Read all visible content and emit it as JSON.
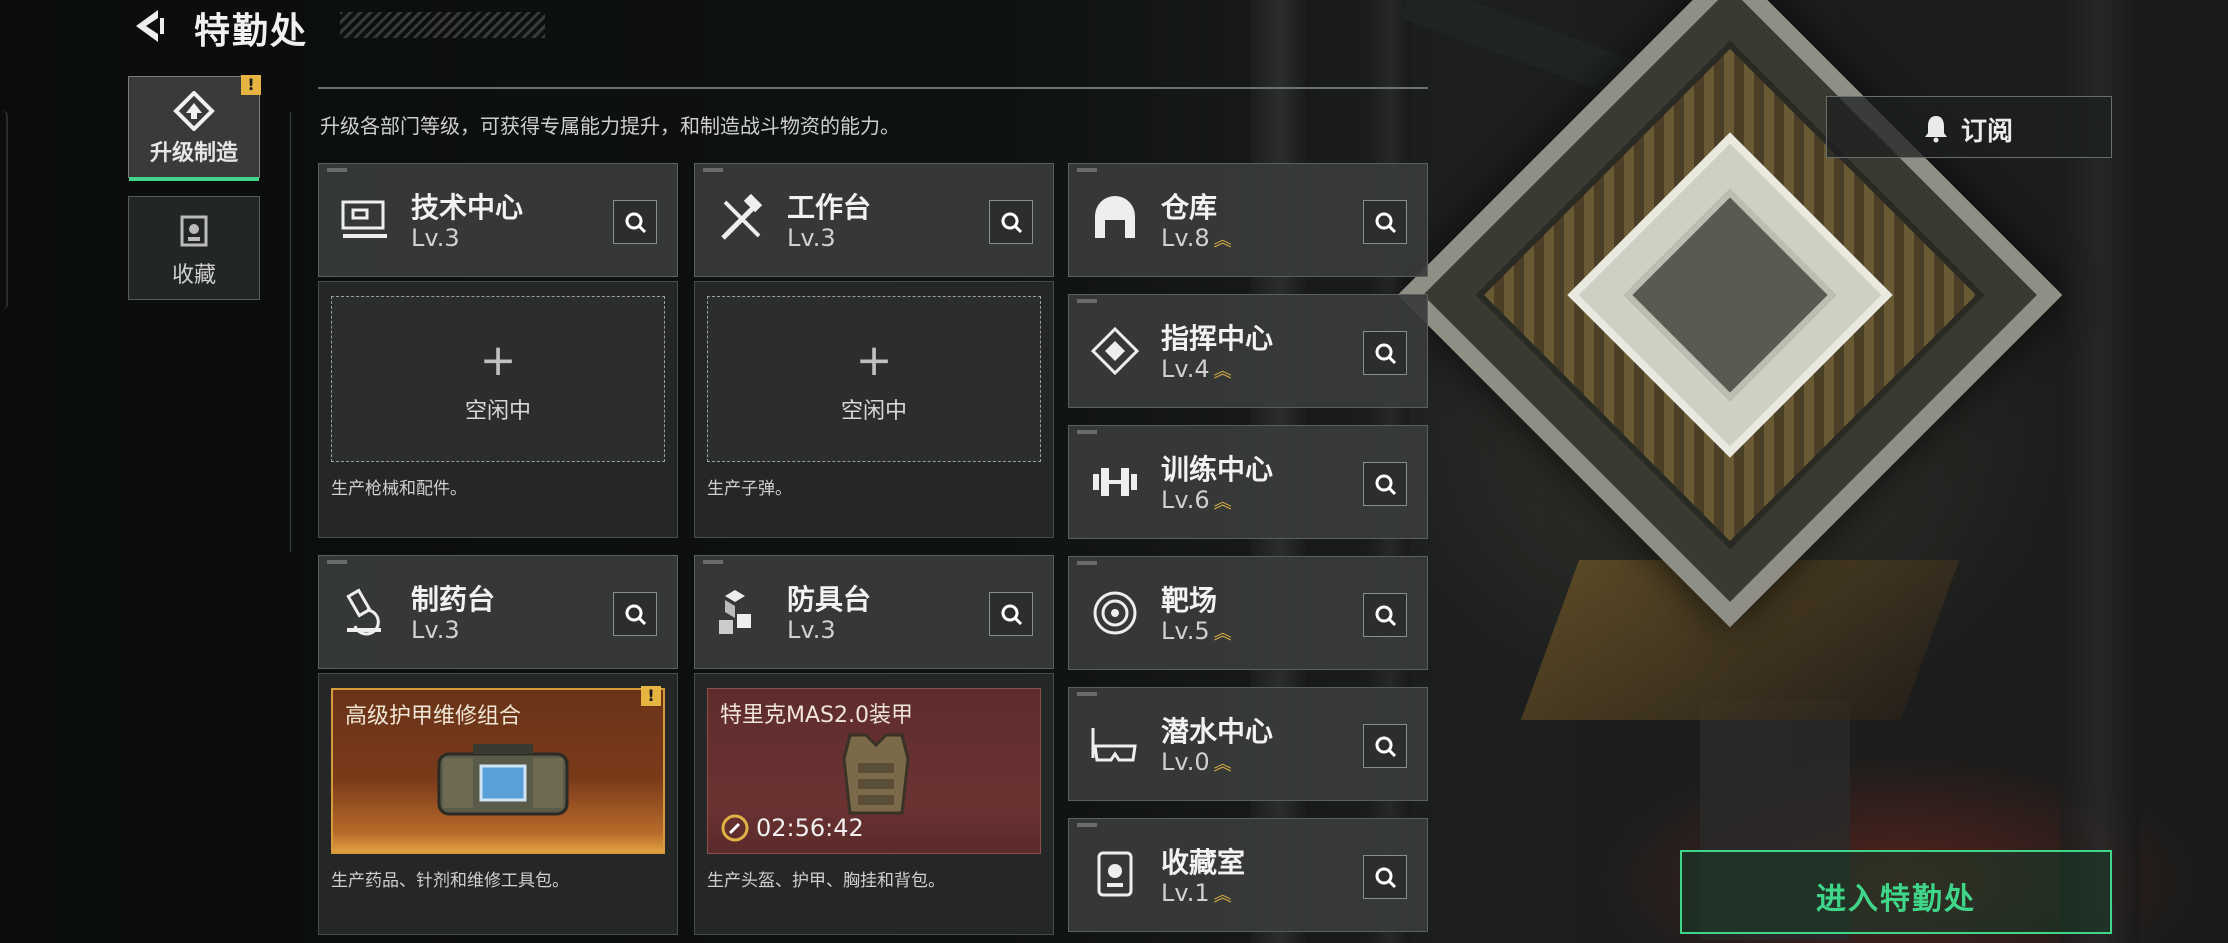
{
  "header": {
    "title": "特勤处"
  },
  "sidebar": {
    "tabs": [
      {
        "label": "升级制造",
        "active": true,
        "badge": "!"
      },
      {
        "label": "收藏",
        "active": false
      }
    ]
  },
  "description": "升级各部门等级，可获得专属能力提升，和制造战斗物资的能力。",
  "subscribe_label": "订阅",
  "enter_label": "进入特勤处",
  "production": [
    {
      "name": "技术中心",
      "level": "Lv.3",
      "icon": "tech-center-icon",
      "slot": {
        "state": "空闲中"
      },
      "desc": "生产枪械和配件。"
    },
    {
      "name": "工作台",
      "level": "Lv.3",
      "icon": "workbench-icon",
      "slot": {
        "state": "空闲中"
      },
      "desc": "生产子弹。"
    },
    {
      "name": "制药台",
      "level": "Lv.3",
      "icon": "pharmacy-icon",
      "slot": {
        "item": "高级护甲维修组合",
        "badge": "!"
      },
      "desc": "生产药品、针剂和维修工具包。"
    },
    {
      "name": "防具台",
      "level": "Lv.3",
      "icon": "armor-bench-icon",
      "slot": {
        "item": "特里克MAS2.0装甲",
        "timer": "02:56:42"
      },
      "desc": "生产头盔、护甲、胸挂和背包。"
    }
  ],
  "departments": [
    {
      "name": "仓库",
      "level": "Lv.8",
      "icon": "warehouse-icon"
    },
    {
      "name": "指挥中心",
      "level": "Lv.4",
      "icon": "command-center-icon"
    },
    {
      "name": "训练中心",
      "level": "Lv.6",
      "icon": "training-center-icon"
    },
    {
      "name": "靶场",
      "level": "Lv.5",
      "icon": "shooting-range-icon"
    },
    {
      "name": "潜水中心",
      "level": "Lv.0",
      "icon": "diving-center-icon"
    },
    {
      "name": "收藏室",
      "level": "Lv.1",
      "icon": "collection-room-icon"
    }
  ],
  "colors": {
    "accent": "#3fd68a",
    "warning": "#e6b440",
    "upgrade": "#e0b245"
  }
}
